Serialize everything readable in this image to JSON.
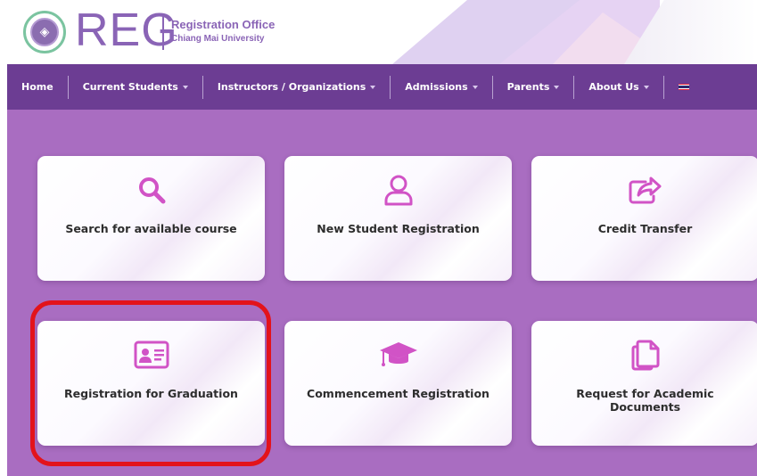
{
  "header": {
    "logo_text": "REG",
    "logo_line1": "Registration Office",
    "logo_line2": "Chiang Mai University"
  },
  "nav": {
    "items": [
      {
        "label": "Home",
        "dropdown": false
      },
      {
        "label": "Current Students",
        "dropdown": true
      },
      {
        "label": "Instructors / Organizations",
        "dropdown": true
      },
      {
        "label": "Admissions",
        "dropdown": true
      },
      {
        "label": "Parents",
        "dropdown": true
      },
      {
        "label": "About Us",
        "dropdown": true
      }
    ],
    "language_flag": "thai-flag-icon"
  },
  "cards": [
    {
      "label": "Search for available course",
      "icon": "search-icon"
    },
    {
      "label": "New Student Registration",
      "icon": "user-icon"
    },
    {
      "label": "Credit Transfer",
      "icon": "share-icon"
    },
    {
      "label": "Registration for Graduation",
      "icon": "id-card-icon"
    },
    {
      "label": "Commencement Registration",
      "icon": "graduation-cap-icon"
    },
    {
      "label": "Request for Academic Documents",
      "icon": "documents-icon"
    }
  ],
  "colors": {
    "brand_purple": "#8a64b6",
    "nav_bg": "#6c3d93",
    "main_bg": "#a96dc1",
    "icon_pink": "#d153c6",
    "highlight_red": "#e3131b"
  }
}
